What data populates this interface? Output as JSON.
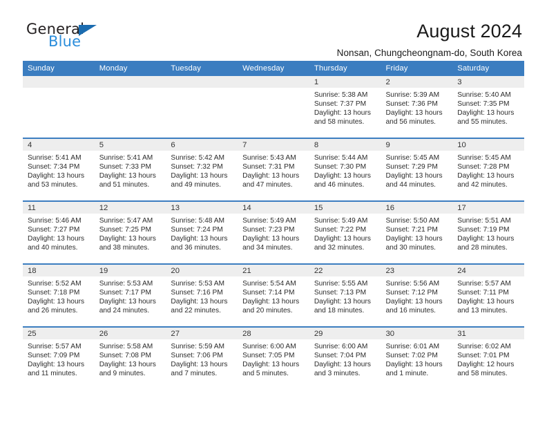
{
  "brand": {
    "name_top": "General",
    "name_bottom": "Blue",
    "triangle_color": "#1b6cb0",
    "blue_text_color": "#2b8ddb"
  },
  "header": {
    "title": "August 2024",
    "subtitle": "Nonsan, Chungcheongnam-do, South Korea"
  },
  "theme": {
    "header_row_bg": "#3b7dc0",
    "header_row_text": "#ffffff",
    "daynum_band_bg": "#eeeeee",
    "cell_bg": "#ffffff",
    "row_border": "#3b7dc0"
  },
  "calendar": {
    "weekday_headers": [
      "Sunday",
      "Monday",
      "Tuesday",
      "Wednesday",
      "Thursday",
      "Friday",
      "Saturday"
    ],
    "labels": {
      "sunrise": "Sunrise:",
      "sunset": "Sunset:",
      "daylight": "Daylight:"
    },
    "weeks": [
      [
        {
          "day": "",
          "empty": true
        },
        {
          "day": "",
          "empty": true
        },
        {
          "day": "",
          "empty": true
        },
        {
          "day": "",
          "empty": true
        },
        {
          "day": "1",
          "sunrise": "Sunrise: 5:38 AM",
          "sunset": "Sunset: 7:37 PM",
          "daylight": "Daylight: 13 hours and 58 minutes."
        },
        {
          "day": "2",
          "sunrise": "Sunrise: 5:39 AM",
          "sunset": "Sunset: 7:36 PM",
          "daylight": "Daylight: 13 hours and 56 minutes."
        },
        {
          "day": "3",
          "sunrise": "Sunrise: 5:40 AM",
          "sunset": "Sunset: 7:35 PM",
          "daylight": "Daylight: 13 hours and 55 minutes."
        }
      ],
      [
        {
          "day": "4",
          "sunrise": "Sunrise: 5:41 AM",
          "sunset": "Sunset: 7:34 PM",
          "daylight": "Daylight: 13 hours and 53 minutes."
        },
        {
          "day": "5",
          "sunrise": "Sunrise: 5:41 AM",
          "sunset": "Sunset: 7:33 PM",
          "daylight": "Daylight: 13 hours and 51 minutes."
        },
        {
          "day": "6",
          "sunrise": "Sunrise: 5:42 AM",
          "sunset": "Sunset: 7:32 PM",
          "daylight": "Daylight: 13 hours and 49 minutes."
        },
        {
          "day": "7",
          "sunrise": "Sunrise: 5:43 AM",
          "sunset": "Sunset: 7:31 PM",
          "daylight": "Daylight: 13 hours and 47 minutes."
        },
        {
          "day": "8",
          "sunrise": "Sunrise: 5:44 AM",
          "sunset": "Sunset: 7:30 PM",
          "daylight": "Daylight: 13 hours and 46 minutes."
        },
        {
          "day": "9",
          "sunrise": "Sunrise: 5:45 AM",
          "sunset": "Sunset: 7:29 PM",
          "daylight": "Daylight: 13 hours and 44 minutes."
        },
        {
          "day": "10",
          "sunrise": "Sunrise: 5:45 AM",
          "sunset": "Sunset: 7:28 PM",
          "daylight": "Daylight: 13 hours and 42 minutes."
        }
      ],
      [
        {
          "day": "11",
          "sunrise": "Sunrise: 5:46 AM",
          "sunset": "Sunset: 7:27 PM",
          "daylight": "Daylight: 13 hours and 40 minutes."
        },
        {
          "day": "12",
          "sunrise": "Sunrise: 5:47 AM",
          "sunset": "Sunset: 7:25 PM",
          "daylight": "Daylight: 13 hours and 38 minutes."
        },
        {
          "day": "13",
          "sunrise": "Sunrise: 5:48 AM",
          "sunset": "Sunset: 7:24 PM",
          "daylight": "Daylight: 13 hours and 36 minutes."
        },
        {
          "day": "14",
          "sunrise": "Sunrise: 5:49 AM",
          "sunset": "Sunset: 7:23 PM",
          "daylight": "Daylight: 13 hours and 34 minutes."
        },
        {
          "day": "15",
          "sunrise": "Sunrise: 5:49 AM",
          "sunset": "Sunset: 7:22 PM",
          "daylight": "Daylight: 13 hours and 32 minutes."
        },
        {
          "day": "16",
          "sunrise": "Sunrise: 5:50 AM",
          "sunset": "Sunset: 7:21 PM",
          "daylight": "Daylight: 13 hours and 30 minutes."
        },
        {
          "day": "17",
          "sunrise": "Sunrise: 5:51 AM",
          "sunset": "Sunset: 7:19 PM",
          "daylight": "Daylight: 13 hours and 28 minutes."
        }
      ],
      [
        {
          "day": "18",
          "sunrise": "Sunrise: 5:52 AM",
          "sunset": "Sunset: 7:18 PM",
          "daylight": "Daylight: 13 hours and 26 minutes."
        },
        {
          "day": "19",
          "sunrise": "Sunrise: 5:53 AM",
          "sunset": "Sunset: 7:17 PM",
          "daylight": "Daylight: 13 hours and 24 minutes."
        },
        {
          "day": "20",
          "sunrise": "Sunrise: 5:53 AM",
          "sunset": "Sunset: 7:16 PM",
          "daylight": "Daylight: 13 hours and 22 minutes."
        },
        {
          "day": "21",
          "sunrise": "Sunrise: 5:54 AM",
          "sunset": "Sunset: 7:14 PM",
          "daylight": "Daylight: 13 hours and 20 minutes."
        },
        {
          "day": "22",
          "sunrise": "Sunrise: 5:55 AM",
          "sunset": "Sunset: 7:13 PM",
          "daylight": "Daylight: 13 hours and 18 minutes."
        },
        {
          "day": "23",
          "sunrise": "Sunrise: 5:56 AM",
          "sunset": "Sunset: 7:12 PM",
          "daylight": "Daylight: 13 hours and 16 minutes."
        },
        {
          "day": "24",
          "sunrise": "Sunrise: 5:57 AM",
          "sunset": "Sunset: 7:11 PM",
          "daylight": "Daylight: 13 hours and 13 minutes."
        }
      ],
      [
        {
          "day": "25",
          "sunrise": "Sunrise: 5:57 AM",
          "sunset": "Sunset: 7:09 PM",
          "daylight": "Daylight: 13 hours and 11 minutes."
        },
        {
          "day": "26",
          "sunrise": "Sunrise: 5:58 AM",
          "sunset": "Sunset: 7:08 PM",
          "daylight": "Daylight: 13 hours and 9 minutes."
        },
        {
          "day": "27",
          "sunrise": "Sunrise: 5:59 AM",
          "sunset": "Sunset: 7:06 PM",
          "daylight": "Daylight: 13 hours and 7 minutes."
        },
        {
          "day": "28",
          "sunrise": "Sunrise: 6:00 AM",
          "sunset": "Sunset: 7:05 PM",
          "daylight": "Daylight: 13 hours and 5 minutes."
        },
        {
          "day": "29",
          "sunrise": "Sunrise: 6:00 AM",
          "sunset": "Sunset: 7:04 PM",
          "daylight": "Daylight: 13 hours and 3 minutes."
        },
        {
          "day": "30",
          "sunrise": "Sunrise: 6:01 AM",
          "sunset": "Sunset: 7:02 PM",
          "daylight": "Daylight: 13 hours and 1 minute."
        },
        {
          "day": "31",
          "sunrise": "Sunrise: 6:02 AM",
          "sunset": "Sunset: 7:01 PM",
          "daylight": "Daylight: 12 hours and 58 minutes."
        }
      ]
    ]
  }
}
